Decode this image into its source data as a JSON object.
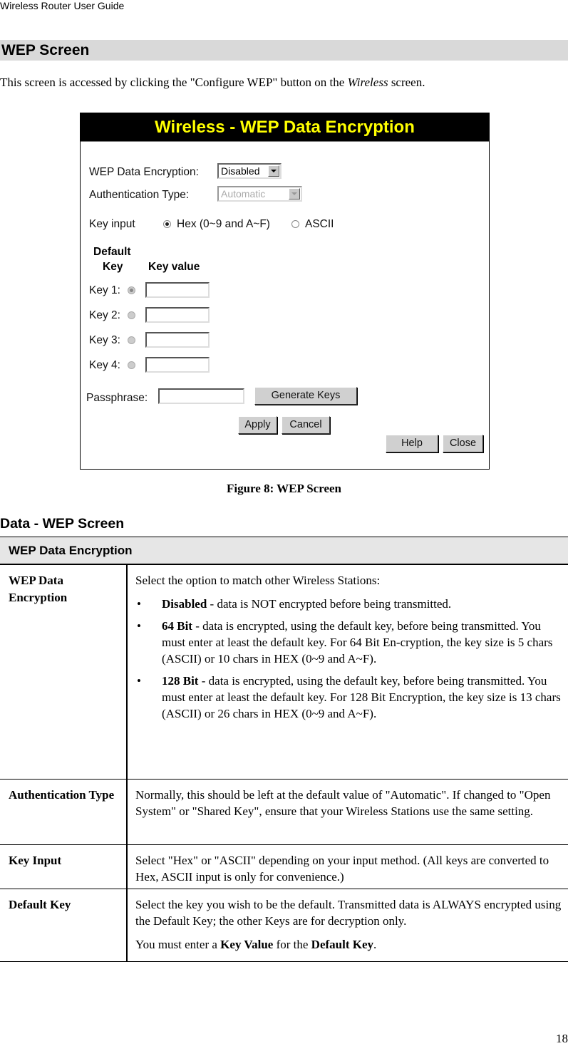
{
  "document": {
    "running_header": "Wireless Router User Guide",
    "section_title": "WEP Screen",
    "intro": {
      "before": "This screen is accessed by clicking the \"Configure WEP\" button on the ",
      "italic": "Wireless",
      "after": " screen."
    },
    "figure_caption": "Figure 8: WEP Screen",
    "data_title": "Data - WEP Screen",
    "page_number": "18"
  },
  "figure": {
    "title": "Wireless - WEP Data Encryption",
    "title_color": "#ffff00",
    "wep_encryption": {
      "label": "WEP Data Encryption:",
      "value": "Disabled"
    },
    "auth_type": {
      "label": "Authentication Type:",
      "value": "Automatic",
      "disabled": true
    },
    "key_input": {
      "label": "Key input",
      "options": [
        {
          "label": "Hex (0~9 and A~F)",
          "checked": true
        },
        {
          "label": "ASCII",
          "checked": false
        }
      ]
    },
    "columns": {
      "default_key_line1": "Default",
      "default_key_line2": "Key",
      "key_value": "Key value"
    },
    "keys": [
      {
        "label": "Key 1:",
        "default": true,
        "value": ""
      },
      {
        "label": "Key 2:",
        "default": false,
        "value": ""
      },
      {
        "label": "Key 3:",
        "default": false,
        "value": ""
      },
      {
        "label": "Key 4:",
        "default": false,
        "value": ""
      }
    ],
    "passphrase": {
      "label": "Passphrase:",
      "value": ""
    },
    "buttons": {
      "generate": "Generate Keys",
      "apply": "Apply",
      "cancel": "Cancel",
      "help": "Help",
      "close": "Close"
    }
  },
  "table": {
    "header": "WEP Data Encryption",
    "rows": [
      {
        "term": "WEP Data Encryption",
        "intro": "Select the option to match other Wireless Stations:",
        "bullets": [
          {
            "bold": "Disabled",
            "text": " - data is NOT encrypted before being transmitted."
          },
          {
            "bold": "64 Bit",
            "text": " - data is encrypted, using the default key, before being transmitted. You must enter at least the default key. For 64 Bit En-cryption, the key size is 5 chars (ASCII) or 10 chars in HEX (0~9 and A~F)."
          },
          {
            "bold": "128 Bit",
            "text": " - data is encrypted, using the default key, before being transmitted. You must enter at least the default key. For 128 Bit Encryption, the key size is 13 chars (ASCII) or 26 chars in HEX (0~9 and A~F)."
          }
        ]
      },
      {
        "term": "Authentication Type",
        "text": "Normally, this should be left at the default value of \"Automatic\".  If changed to \"Open System\" or \"Shared Key\", ensure that your Wireless Stations use the same setting."
      },
      {
        "term": "Key Input",
        "text": "Select \"Hex\" or \"ASCII\" depending on your input method. (All keys are converted to Hex, ASCII input is only for convenience.)"
      },
      {
        "term": "Default Key",
        "text": "Select the key you wish to be the default. Transmitted data is ALWAYS encrypted using the Default Key; the other Keys are for decryption only.",
        "note_prefix": "You must enter a ",
        "note_bold1": "Key Value",
        "note_mid": " for the ",
        "note_bold2": "Default Key",
        "note_suffix": "."
      }
    ]
  }
}
